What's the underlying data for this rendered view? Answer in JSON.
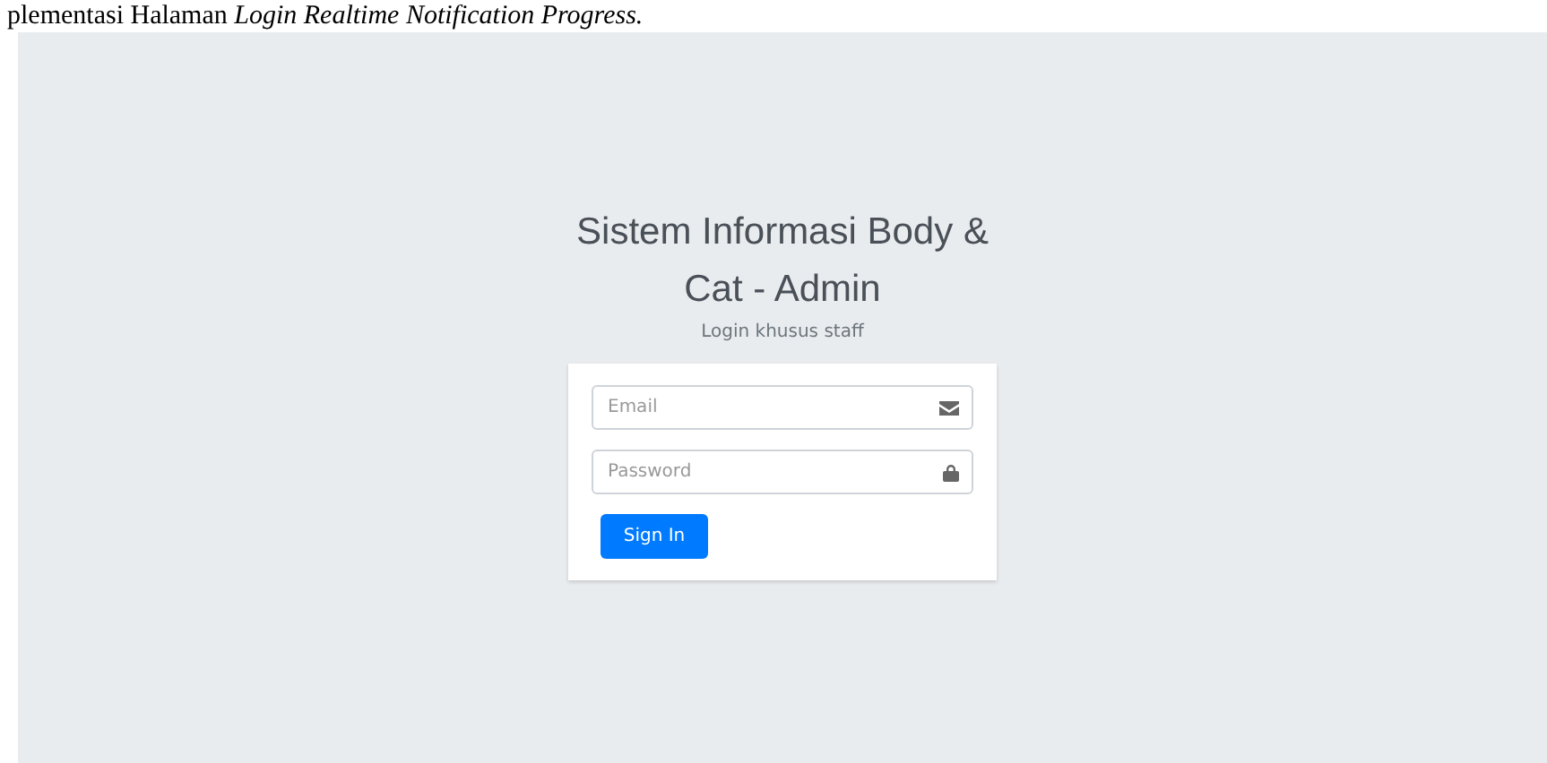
{
  "caption": "plementasi Halaman *Login Realtime Notification Progress.*",
  "login": {
    "title": "Sistem Informasi Body & Cat - Admin",
    "subtitle": "Login khusus staff",
    "fields": [
      {
        "kind": "email",
        "placeholder": "Email"
      },
      {
        "kind": "password",
        "placeholder": "Password"
      }
    ],
    "button": "Sign In"
  }
}
